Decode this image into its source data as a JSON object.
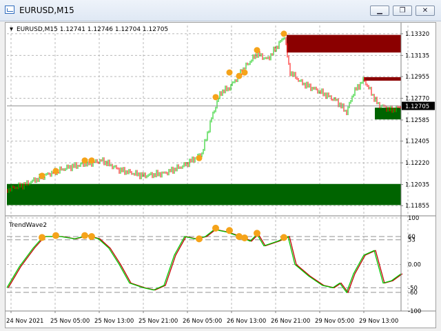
{
  "window": {
    "title": "EURUSD,M15",
    "minimize_icon": "minimize-icon",
    "restore_icon": "restore-icon",
    "close_icon": "close-icon"
  },
  "chart": {
    "header": "EURUSD,M15  1.12741 1.12746 1.12704 1.12705",
    "current_price_label": "1.12705",
    "price_ticks": [
      "1.13320",
      "1.13135",
      "1.12955",
      "1.12770",
      "1.12585",
      "1.12405",
      "1.12220",
      "1.12035",
      "1.11855"
    ],
    "time_ticks": [
      "24 Nov 2021",
      "25 Nov 05:00",
      "25 Nov 13:00",
      "25 Nov 21:00",
      "26 Nov 05:00",
      "26 Nov 13:00",
      "26 Nov 21:00",
      "29 Nov 05:00",
      "29 Nov 13:00"
    ],
    "indicator_name": "TrendWave2",
    "indicator_ticks": [
      "100",
      "60",
      "53",
      "0.00",
      "-50",
      "-60",
      "-100"
    ],
    "colors": {
      "bull_candle": "#00c800",
      "bear_candle": "#ff0000",
      "supply_zone": "#8b0000",
      "demand_zone": "#006400",
      "signal_dot": "#f5a31a",
      "wave_fast": "#00c800",
      "wave_slow": "#c00000"
    }
  },
  "chart_data": {
    "type": "line",
    "title": "EURUSD,M15",
    "ylim": [
      1.1178,
      1.1339
    ],
    "price_series_approx": {
      "name": "EURUSD close",
      "points": [
        [
          "24 Nov 2021",
          1.1199
        ],
        [
          "24 Nov 2021",
          1.1205
        ],
        [
          "25 Nov 05:00",
          1.1218
        ],
        [
          "25 Nov 05:00",
          1.1216
        ],
        [
          "25 Nov 13:00",
          1.1225
        ],
        [
          "25 Nov 13:00",
          1.1219
        ],
        [
          "25 Nov 21:00",
          1.1212
        ],
        [
          "25 Nov 21:00",
          1.122
        ],
        [
          "26 Nov 05:00",
          1.1245
        ],
        [
          "26 Nov 05:00",
          1.1278
        ],
        [
          "26 Nov 13:00",
          1.13
        ],
        [
          "26 Nov 13:00",
          1.1318
        ],
        [
          "26 Nov 21:00",
          1.133
        ],
        [
          "26 Nov 21:00",
          1.1293
        ],
        [
          "29 Nov 05:00",
          1.1267
        ],
        [
          "29 Nov 05:00",
          1.1293
        ],
        [
          "29 Nov 13:00",
          1.1262
        ],
        [
          "29 Nov 13:00",
          1.127
        ]
      ]
    },
    "zones": [
      {
        "type": "supply",
        "from": 1.1316,
        "to": 1.1331
      },
      {
        "type": "supply",
        "from": 1.1292,
        "to": 1.1295
      },
      {
        "type": "demand",
        "from": 1.1186,
        "to": 1.1204
      },
      {
        "type": "demand",
        "from": 1.1259,
        "to": 1.1269
      }
    ],
    "indicator": {
      "name": "TrendWave2",
      "ylim": [
        -100,
        100
      ],
      "levels": [
        60,
        53,
        -50,
        -60
      ]
    }
  }
}
